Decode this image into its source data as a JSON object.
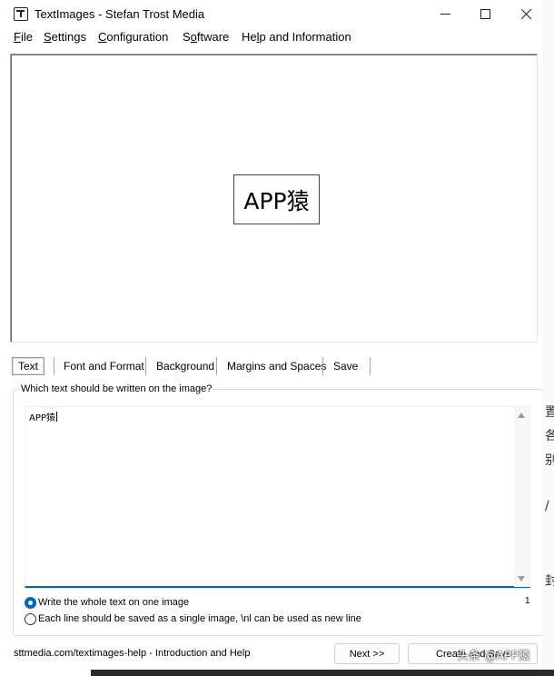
{
  "window": {
    "title": "TextImages - Stefan Trost Media"
  },
  "menu": [
    {
      "ul": "F",
      "rest": "ile"
    },
    {
      "ul": "S",
      "rest": "ettings"
    },
    {
      "ul": "C",
      "rest": "onfiguration"
    },
    {
      "pre": "S",
      "ul": "o",
      "rest": "ftware"
    },
    {
      "pre": "He",
      "ul": "l",
      "rest": "p and Information"
    }
  ],
  "preview": {
    "text": "APP猿"
  },
  "tabs": [
    "Text",
    "Font and Format",
    "Background",
    "Margins and Spaces",
    "Save"
  ],
  "text_panel": {
    "group_label": "Which text should be written on the image?",
    "value": "APP猿",
    "line_count": "1",
    "radio_whole": "Write the whole text on one image",
    "radio_each": "Each line should be saved as a single image, \\nl can be used as new line"
  },
  "footer": {
    "help_link": "sttmedia.com/textimages-help - Introduction and Help",
    "next_button": "Next >>",
    "create_button": "Create and Save"
  },
  "watermark": "头条 @APP猿",
  "background_window_chars": [
    "置",
    "各",
    "别",
    "/",
    "封"
  ],
  "colors": {
    "accent": "#0067b8",
    "border": "#a0a0a0"
  }
}
